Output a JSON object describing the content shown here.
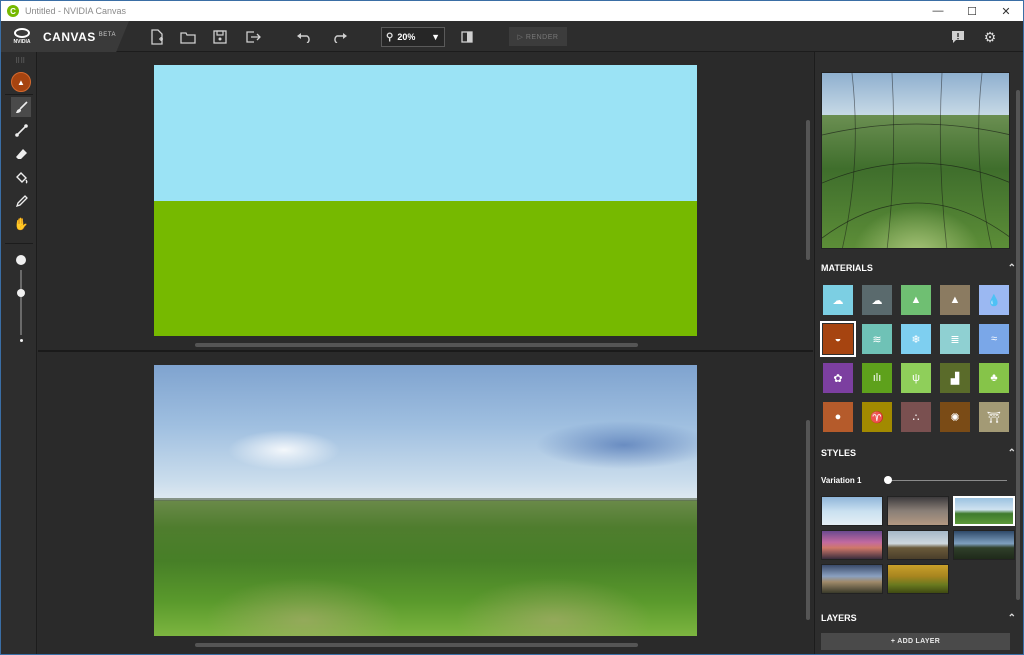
{
  "window": {
    "title": "Untitled - NVIDIA Canvas",
    "controls": {
      "minimize": "—",
      "maximize": "☐",
      "close": "✕"
    }
  },
  "toolbar": {
    "app_name": "CANVAS",
    "app_badge": "BETA",
    "logo_text": "NVIDIA",
    "icons": [
      "new-file-icon",
      "open-folder-icon",
      "save-icon",
      "export-icon",
      "undo-icon",
      "redo-icon",
      "compare-icon"
    ],
    "zoom_value": "20%",
    "render_label": "▷ RENDER",
    "right_icons": [
      "feedback-icon",
      "settings-icon"
    ]
  },
  "tools": [
    "material-picker",
    "brush-icon",
    "line-icon",
    "eraser-icon",
    "fill-icon",
    "eyedropper-icon",
    "hand-icon"
  ],
  "brush_size": {
    "level": 0.65
  },
  "colors": {
    "sky": "#9be3f5",
    "grass": "#76b900",
    "selected_material": "#a64410",
    "accent": "#76b900"
  },
  "right_panel": {
    "materials_title": "MATERIALS",
    "materials": [
      {
        "name": "sky-sunset-icon",
        "color": "#7ccfe3",
        "glyph": "☁"
      },
      {
        "name": "cloud-icon",
        "color": "#5a6a6d",
        "glyph": "☁"
      },
      {
        "name": "hill-icon",
        "color": "#6fbf72",
        "glyph": "▲"
      },
      {
        "name": "mountain-icon",
        "color": "#8b7b61",
        "glyph": "▲"
      },
      {
        "name": "water-drop-icon",
        "color": "#9bb8f2",
        "glyph": "💧"
      },
      {
        "name": "sand-icon",
        "color": "#a64410",
        "glyph": "◒"
      },
      {
        "name": "fog-icon",
        "color": "#6fc2b6",
        "glyph": "≋"
      },
      {
        "name": "snow-icon",
        "color": "#7ecff0",
        "glyph": "❄"
      },
      {
        "name": "river-icon",
        "color": "#8fd0d2",
        "glyph": "≣"
      },
      {
        "name": "sea-icon",
        "color": "#7aa7e8",
        "glyph": "≈"
      },
      {
        "name": "flower-icon",
        "color": "#7c3fa0",
        "glyph": "✿"
      },
      {
        "name": "grass-icon",
        "color": "#5ea11c",
        "glyph": "ılı"
      },
      {
        "name": "tall-grass-icon",
        "color": "#8fcf5a",
        "glyph": "ψ"
      },
      {
        "name": "bush-icon",
        "color": "#5a6b2a",
        "glyph": "▟"
      },
      {
        "name": "tree-icon",
        "color": "#86c449",
        "glyph": "♣"
      },
      {
        "name": "stone-icon",
        "color": "#b55b2b",
        "glyph": "●"
      },
      {
        "name": "palm-icon",
        "color": "#a28a00",
        "glyph": "♈"
      },
      {
        "name": "gravel-icon",
        "color": "#7a5050",
        "glyph": "∴"
      },
      {
        "name": "dirt-icon",
        "color": "#7a4b16",
        "glyph": "✺"
      },
      {
        "name": "building-icon",
        "color": "#a39a75",
        "glyph": "⛩"
      }
    ],
    "styles_title": "STYLES",
    "variation_label": "Variation 1",
    "variation_level": 0.0,
    "style_thumbs": [
      {
        "name": "style-thumb-1",
        "bg": "linear-gradient(180deg,#8fb6d9 0%,#c9e0f0 50%,#e5eef5 100%)"
      },
      {
        "name": "style-thumb-2",
        "bg": "linear-gradient(180deg,#3d3b3d 0%,#8a7f77 50%,#b49982 100%)"
      },
      {
        "name": "style-thumb-3",
        "bg": "linear-gradient(180deg,#9bc2e0 0%,#cfe2f0 45%,#3f7a2c 60%,#5d9a3a 100%)"
      },
      {
        "name": "style-thumb-4",
        "bg": "linear-gradient(180deg,#6b4a8f 0%,#c26aa0 40%,#d0786a 60%,#3a2d3d 100%)"
      },
      {
        "name": "style-thumb-5",
        "bg": "linear-gradient(180deg,#a5b8c8 0%,#cfd8de 45%,#6a5a3a 60%,#4a3e2a 100%)"
      },
      {
        "name": "style-thumb-6",
        "bg": "linear-gradient(180deg,#2f4a6a 0%,#7fa0c0 45%,#2f3f2a 60%,#1f2a1a 100%)"
      },
      {
        "name": "style-thumb-7",
        "bg": "linear-gradient(180deg,#3a4a6a 0%,#8aa0c0 40%,#a08a6a 60%,#3a3a2a 100%)"
      },
      {
        "name": "style-thumb-8",
        "bg": "linear-gradient(180deg,#c9a02a 0%,#a8851f 40%,#6a7a1f 70%,#3f4a12 100%)"
      }
    ],
    "layers_title": "LAYERS",
    "add_layer_label": "+ ADD LAYER"
  }
}
